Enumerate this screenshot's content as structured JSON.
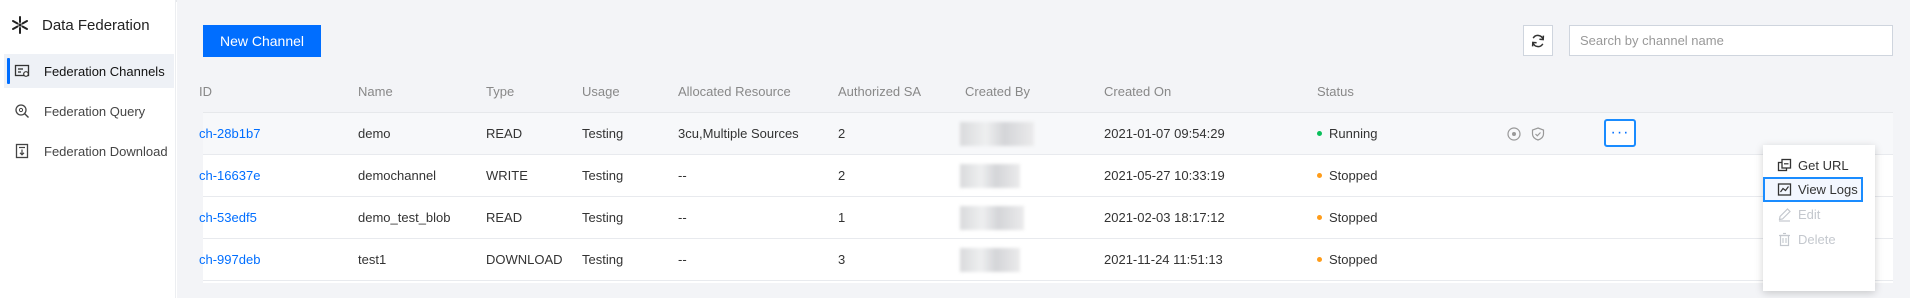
{
  "sidebar": {
    "title": "Data Federation",
    "items": [
      {
        "label": "Federation Channels",
        "icon": "channels-icon",
        "active": true
      },
      {
        "label": "Federation Query",
        "icon": "query-icon",
        "active": false
      },
      {
        "label": "Federation Download",
        "icon": "download-icon",
        "active": false
      }
    ]
  },
  "toolbar": {
    "new_channel_label": "New Channel",
    "refresh_icon": "refresh-icon",
    "search_placeholder": "Search by channel name",
    "search_value": ""
  },
  "table": {
    "columns": [
      "ID",
      "Name",
      "Type",
      "Usage",
      "Allocated Resource",
      "Authorized SA",
      "Created By",
      "Created On",
      "Status"
    ],
    "rows": [
      {
        "id": "ch-28b1b7",
        "name": "demo",
        "type": "READ",
        "usage": "Testing",
        "resource": "3cu,Multiple Sources",
        "authorized_sa": "2",
        "created_on": "2021-01-07 09:54:29",
        "status": "Running",
        "status_color": "#0abf5b"
      },
      {
        "id": "ch-16637e",
        "name": "demochannel",
        "type": "WRITE",
        "usage": "Testing",
        "resource": "--",
        "authorized_sa": "2",
        "created_on": "2021-05-27 10:33:19",
        "status": "Stopped",
        "status_color": "#ff9c19"
      },
      {
        "id": "ch-53edf5",
        "name": "demo_test_blob",
        "type": "READ",
        "usage": "Testing",
        "resource": "--",
        "authorized_sa": "1",
        "created_on": "2021-02-03 18:17:12",
        "status": "Stopped",
        "status_color": "#ff9c19"
      },
      {
        "id": "ch-997deb",
        "name": "test1",
        "type": "DOWNLOAD",
        "usage": "Testing",
        "resource": "--",
        "authorized_sa": "3",
        "created_on": "2021-11-24 11:51:13",
        "status": "Stopped",
        "status_color": "#ff9c19"
      }
    ]
  },
  "row_actions": {
    "icons": [
      "stop-icon",
      "shield-icon",
      "more-icon"
    ],
    "more_label": "···"
  },
  "dropdown_menu": {
    "items": [
      {
        "label": "Get URL",
        "icon": "copy-url-icon",
        "disabled": false
      },
      {
        "label": "View Logs",
        "icon": "logs-icon",
        "disabled": false
      },
      {
        "label": "Edit",
        "icon": "edit-icon",
        "disabled": true
      },
      {
        "label": "Delete",
        "icon": "delete-icon",
        "disabled": true
      }
    ]
  },
  "colors": {
    "accent": "#006eff",
    "running": "#0abf5b",
    "stopped": "#ff9c19",
    "highlight_outline": "#1a8cff"
  }
}
